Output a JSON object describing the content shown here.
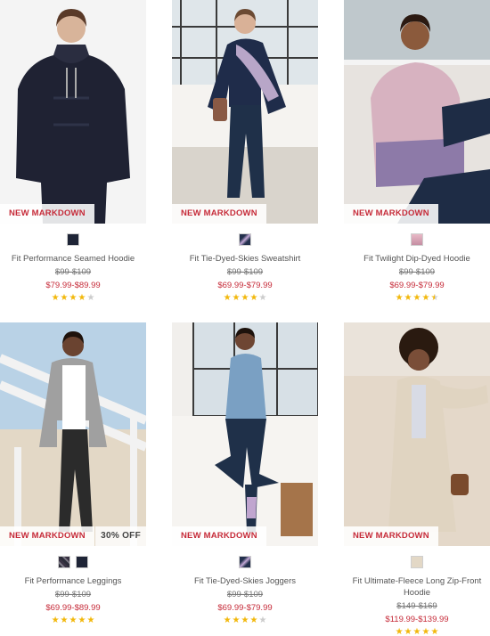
{
  "badge_label": "NEW MARKDOWN",
  "colors": {
    "markdown_red": "#c62b39",
    "star_gold": "#f2b80c",
    "star_grey": "#cccccc"
  },
  "products": [
    {
      "name": "Fit Performance Seamed Hoodie",
      "was_price": "$99-$109",
      "sale_price": "$79.99-$89.99",
      "rating": 4,
      "swatches": [
        "navy-space-dye"
      ],
      "discount": ""
    },
    {
      "name": "Fit Tie-Dyed-Skies Sweatshirt",
      "was_price": "$99-$109",
      "sale_price": "$69.99-$79.99",
      "rating": 4,
      "swatches": [
        "navy-tie-dye"
      ],
      "discount": ""
    },
    {
      "name": "Fit Twilight Dip-Dyed Hoodie",
      "was_price": "$99-$109",
      "sale_price": "$69.99-$79.99",
      "rating": 4.5,
      "swatches": [
        "pink-dip-dye"
      ],
      "discount": ""
    },
    {
      "name": "Fit Performance Leggings",
      "was_price": "$99-$109",
      "sale_price": "$69.99-$89.99",
      "rating": 5,
      "swatches": [
        "camo-print",
        "navy-solid"
      ],
      "discount": "30% OFF"
    },
    {
      "name": "Fit Tie-Dyed-Skies Joggers",
      "was_price": "$99-$109",
      "sale_price": "$69.99-$79.99",
      "rating": 4,
      "swatches": [
        "navy-tie-dye"
      ],
      "discount": ""
    },
    {
      "name": "Fit Ultimate-Fleece Long Zip-Front Hoodie",
      "was_price": "$149-$169",
      "sale_price": "$119.99-$139.99",
      "rating": 5,
      "swatches": [
        "oatmeal"
      ],
      "discount": ""
    }
  ]
}
